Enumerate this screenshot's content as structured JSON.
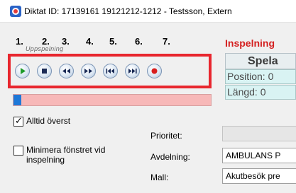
{
  "window": {
    "title": "Diktat ID: 17139161 19121212-1212 - Testsson, Extern"
  },
  "player": {
    "panel_caption": "Uppspelning",
    "step_numbers": [
      "1.",
      "2.",
      "3.",
      "4.",
      "5.",
      "6.",
      "7."
    ],
    "buttons": [
      {
        "name": "play",
        "icon": "play-icon"
      },
      {
        "name": "stop",
        "icon": "stop-icon"
      },
      {
        "name": "rewind",
        "icon": "rewind-icon"
      },
      {
        "name": "fast-forward",
        "icon": "fast-forward-icon"
      },
      {
        "name": "skip-to-start",
        "icon": "skip-start-icon"
      },
      {
        "name": "skip-to-end",
        "icon": "skip-end-icon"
      },
      {
        "name": "record",
        "icon": "record-icon"
      }
    ],
    "progress_fraction": 0.04
  },
  "status": {
    "recording_title": "Inspelning",
    "play_label": "Spela",
    "position_text": "Position: 0",
    "length_text": "Längd:   0"
  },
  "options": {
    "always_on_top": {
      "label": "Alltid överst",
      "checked": true
    },
    "minimize_on_record": {
      "label_line1": "Minimera fönstret vid",
      "label_line2": "inspelning",
      "checked": false
    }
  },
  "form": {
    "priority_label": "Prioritet:",
    "priority_value": "",
    "department_label": "Avdelning:",
    "department_value": "AMBULANS P",
    "template_label": "Mall:",
    "template_value": "Akutbesök pre"
  },
  "colors": {
    "highlight": "#e8262e",
    "record_title": "#d42020",
    "progress_fill": "#1e78d8",
    "progress_track": "#f7b8b8",
    "info_box": "#d9f3f3"
  }
}
